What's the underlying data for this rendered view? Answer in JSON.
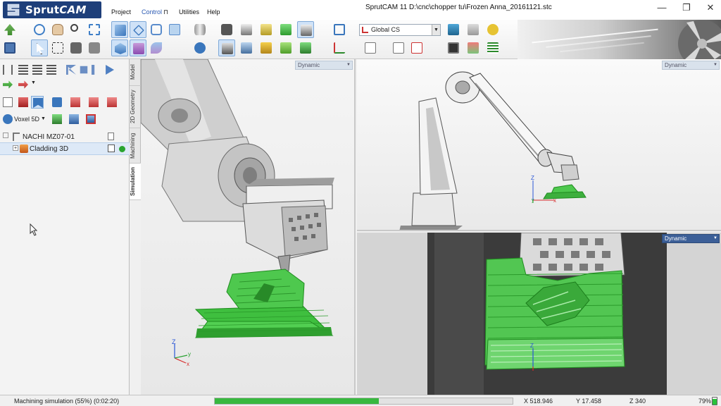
{
  "app": {
    "brand": "SprutCAM",
    "logo_prefix": "Sprut",
    "logo_suffix": "CAM",
    "window_title": "SprutCAM 11   D:\\cnc\\chopper tu\\Frozen Anna_20161121.stc"
  },
  "menu": [
    {
      "label": "Project"
    },
    {
      "label": "Control",
      "pin_icon": "pin-icon"
    },
    {
      "label": "Utilities"
    },
    {
      "label": "Help"
    }
  ],
  "window_controls": {
    "minimize": "—",
    "restore": "❐",
    "close": "✕"
  },
  "ribbon": {
    "coordinate_system": "Global CS",
    "accent_color": "#2b5ab3"
  },
  "left_panel": {
    "tabs": [
      "Model",
      "2D Geometry",
      "Machining",
      "Simulation"
    ],
    "active_tab": "Simulation",
    "voxel_mode": "Voxel 5D",
    "tree": [
      {
        "label": "NACHI MZ07-01",
        "icon": "robot-icon"
      },
      {
        "label": "Cladding 3D",
        "icon": "cladding-operation-icon",
        "selected": true
      }
    ]
  },
  "viewports": [
    {
      "name": "main-view",
      "mode": "Dynamic"
    },
    {
      "name": "robot-overview",
      "mode": "Dynamic"
    },
    {
      "name": "closeup-view",
      "mode": "Dynamic"
    }
  ],
  "axes": {
    "x": "x",
    "y": "y",
    "z": "Z"
  },
  "status": {
    "message": "Machining simulation (55%) (0:02:20)",
    "progress_fraction": 0.55,
    "x": "X 518.946",
    "y": "Y 17.458",
    "z": "Z 340",
    "battery": "79%",
    "battery_fraction": 0.79,
    "progress_color": "#38b83f"
  }
}
